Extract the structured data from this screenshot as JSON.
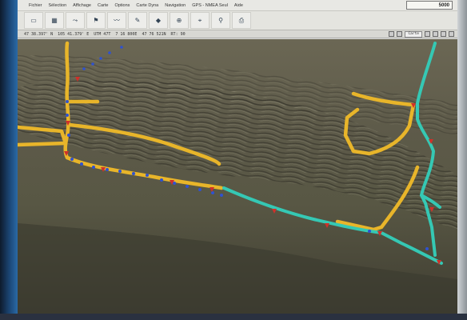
{
  "menu": {
    "items": [
      "Fichier",
      "Sélection",
      "Affichage",
      "Carte",
      "Options",
      "Carte Dyna",
      "Navigation",
      "GPS - NMEA Seul",
      "Aide"
    ]
  },
  "scale": "5000",
  "toolbar": {
    "tools": [
      {
        "icon": "open-map-icon",
        "glyph": "▭",
        "label": ""
      },
      {
        "icon": "layers-icon",
        "glyph": "▦",
        "label": ""
      },
      {
        "icon": "route-icon",
        "glyph": "⤳",
        "label": ""
      },
      {
        "icon": "waypoint-icon",
        "glyph": "⚑",
        "label": ""
      },
      {
        "icon": "track-icon",
        "glyph": "〰",
        "label": ""
      },
      {
        "icon": "pencil-icon",
        "glyph": "✎",
        "label": ""
      },
      {
        "icon": "marker-icon",
        "glyph": "◆",
        "label": ""
      },
      {
        "icon": "center-icon",
        "glyph": "⊕",
        "label": ""
      },
      {
        "icon": "gps-icon",
        "glyph": "⌖",
        "label": ""
      },
      {
        "icon": "zoom-icon",
        "glyph": "⚲",
        "label": ""
      },
      {
        "icon": "print-icon",
        "glyph": "⎙",
        "label": ""
      }
    ]
  },
  "status": {
    "lat": "47 38.397' N",
    "lon": "105 41.379' E",
    "proj": "UTM 47T",
    "east": "7 16 800E",
    "north": "47 76 521N",
    "mode": "RT: 90",
    "tab_label": "Carte"
  },
  "map": {
    "colors": {
      "yellow_route": "#e8b52a",
      "cyan_track": "#35c8b4",
      "blue_points": "#2f52d0",
      "red_waypoints": "#d0302a"
    }
  }
}
